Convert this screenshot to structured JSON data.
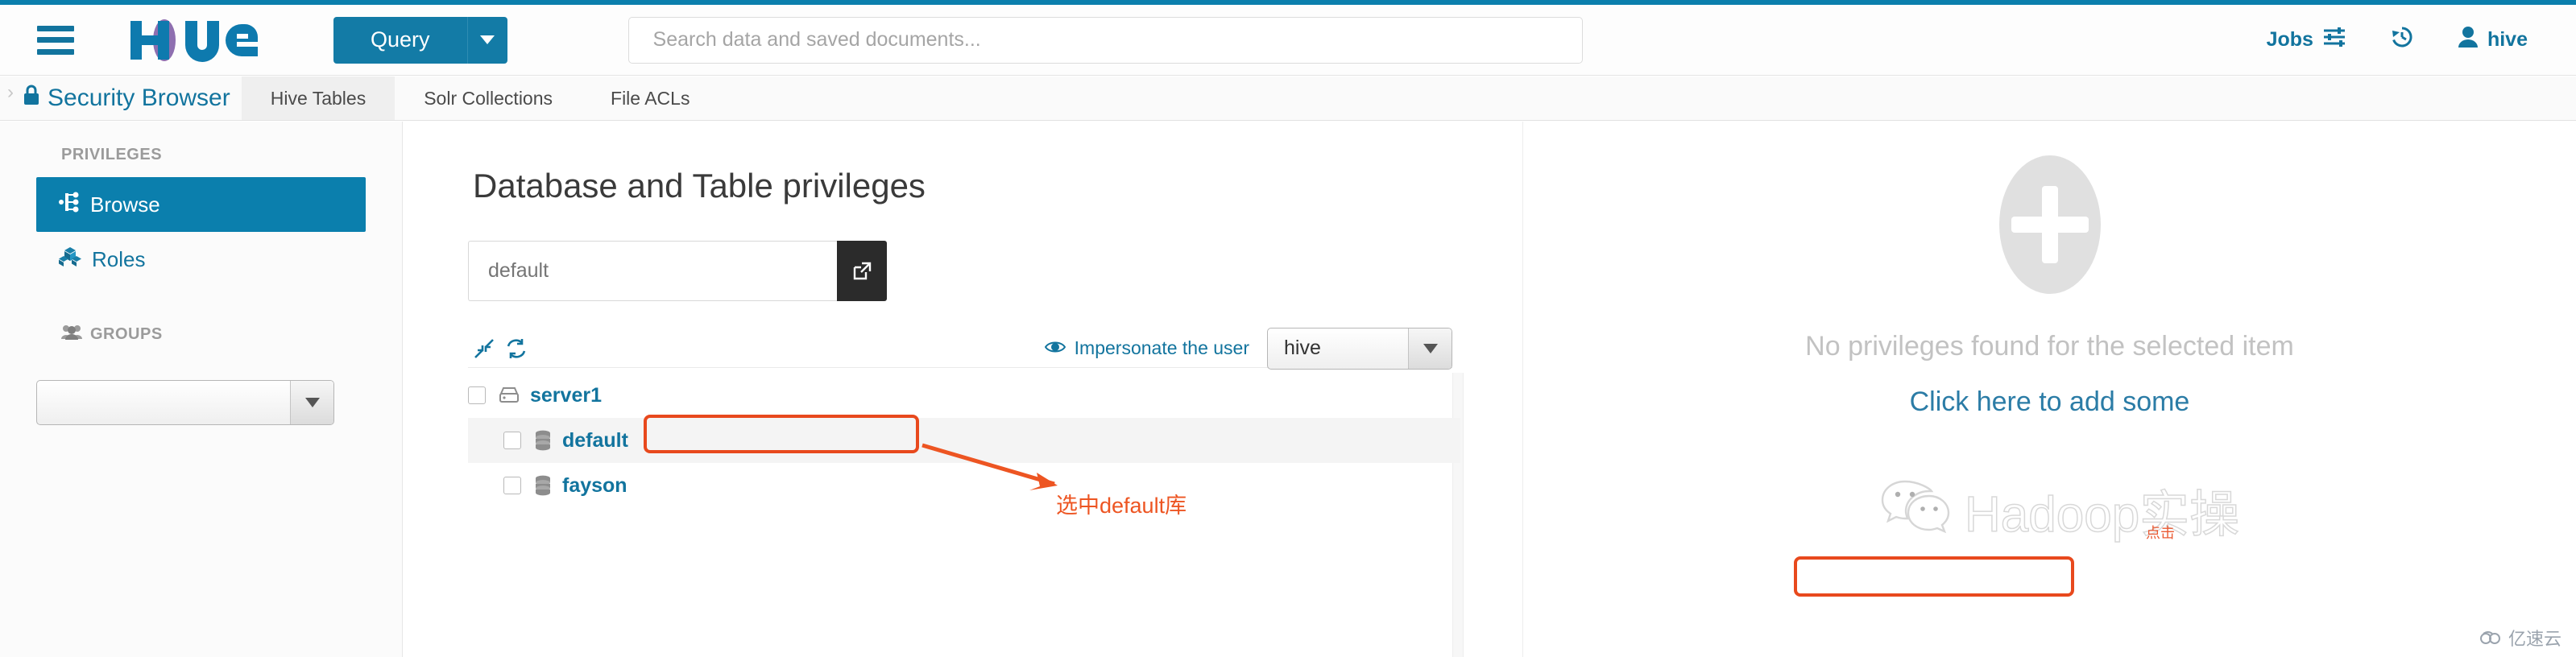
{
  "brand": {
    "name": "Hue",
    "accent": "#0B7FAD"
  },
  "header": {
    "menu_icon": "hamburger-icon",
    "query_label": "Query",
    "query_caret_icon": "chevron-down-icon",
    "search": {
      "placeholder": "Search data and saved documents...",
      "value": ""
    },
    "right_items": [
      {
        "label": "Jobs",
        "icon": "sliders-icon"
      },
      {
        "label": "",
        "icon": "history-icon"
      },
      {
        "label": "hive",
        "icon": "user-icon"
      }
    ]
  },
  "subnav": {
    "collapse_icon": "chevron-right-icon",
    "app_icon": "lock-icon",
    "app_title": "Security Browser",
    "tabs": [
      {
        "label": "Hive Tables",
        "active": true
      },
      {
        "label": "Solr Collections",
        "active": false
      },
      {
        "label": "File ACLs",
        "active": false
      }
    ]
  },
  "sidebar": {
    "privileges_heading": "PRIVILEGES",
    "items": [
      {
        "label": "Browse",
        "icon": "sitemap-icon",
        "active": true
      },
      {
        "label": "Roles",
        "icon": "cubes-icon",
        "active": false
      }
    ],
    "groups_heading": "GROUPS",
    "groups_icon": "group-icon",
    "groups_select": {
      "value": "",
      "caret_icon": "triangle-down-icon"
    }
  },
  "main": {
    "title": "Database and Table privileges",
    "db_search": {
      "value": "default",
      "placeholder": "default"
    },
    "go_button_icon": "external-link-icon",
    "toolbar": {
      "collapse_icon": "collapse-arrows-icon",
      "refresh_icon": "refresh-icon",
      "impersonate_icon": "eye-icon",
      "impersonate_label": "Impersonate the user",
      "impersonate_user": "hive",
      "impersonate_caret_icon": "triangle-down-icon"
    },
    "tree": [
      {
        "label": "server1",
        "icon": "server-icon",
        "level": 0,
        "checked": false,
        "selected": false
      },
      {
        "label": "default",
        "icon": "database-icon",
        "level": 1,
        "checked": false,
        "selected": true
      },
      {
        "label": "fayson",
        "icon": "database-icon",
        "level": 1,
        "checked": false,
        "selected": false
      }
    ]
  },
  "empty_state": {
    "plus_icon": "plus-circle-icon",
    "message": "No privileges found for the selected item",
    "add_link": "Click here to add some"
  },
  "annotations": [
    {
      "name": "select-default-db",
      "text": "选中default库",
      "color": "#ED5522"
    }
  ],
  "watermarks": {
    "center": "Hadoop实操",
    "center_icon": "wechat-icon",
    "center_red": "点击",
    "corner": "亿速云",
    "corner_icon": "cloud-icon"
  }
}
